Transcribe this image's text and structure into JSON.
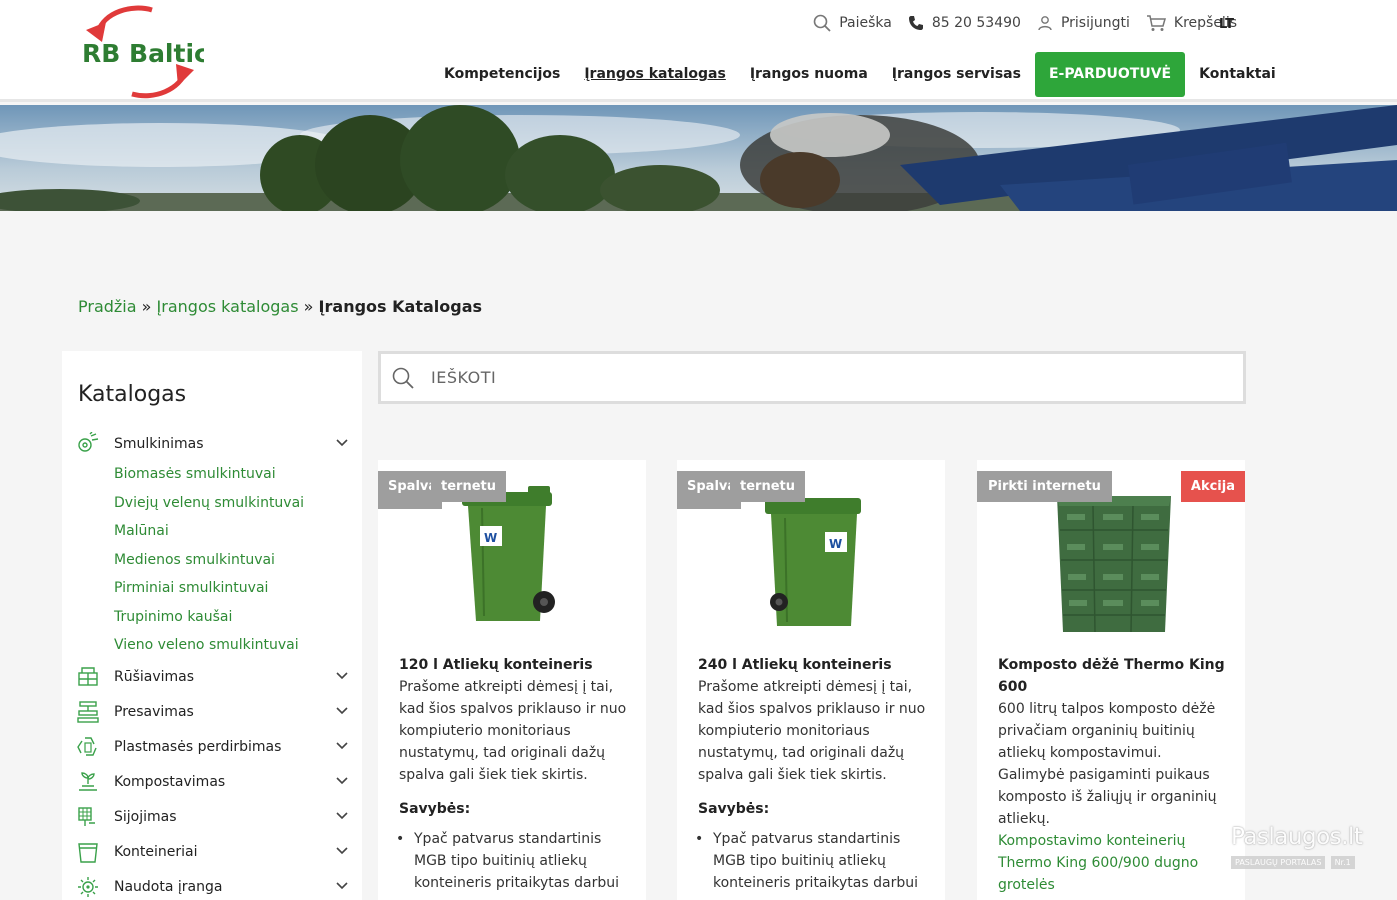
{
  "brand": {
    "logo_text": "RB Baltic",
    "green": "#2e8b35",
    "accent_red": "#e03a3a"
  },
  "topbar": {
    "search_label": "Paieška",
    "phone": "85 20 53490",
    "login_label": "Prisijungti",
    "cart_label": "Krepšelis",
    "language": "LT"
  },
  "nav": {
    "items": [
      {
        "label": "Kompetencijos"
      },
      {
        "label": "Įrangos katalogas"
      },
      {
        "label": "Įrangos nuoma"
      },
      {
        "label": "Įrangos servisas"
      },
      {
        "label": "E-PARDUOTUVĖ"
      },
      {
        "label": "Kontaktai"
      }
    ]
  },
  "breadcrumb": {
    "home": "Pradžia",
    "sep1": "»",
    "catalog": "Įrangos katalogas",
    "sep2": "»",
    "current": "Įrangos Katalogas"
  },
  "sidebar": {
    "title": "Katalogas",
    "categories": [
      {
        "label": "Smulkinimas",
        "icon": "shredder-icon"
      },
      {
        "label": "Rūšiavimas",
        "icon": "sorting-icon"
      },
      {
        "label": "Presavimas",
        "icon": "press-icon"
      },
      {
        "label": "Plastmasės perdirbimas",
        "icon": "recycle-icon"
      },
      {
        "label": "Kompostavimas",
        "icon": "compost-icon"
      },
      {
        "label": "Sijojimas",
        "icon": "sieve-icon"
      },
      {
        "label": "Konteineriai",
        "icon": "container-icon"
      },
      {
        "label": "Naudota įranga",
        "icon": "used-equipment-icon"
      }
    ],
    "subcategories": [
      "Biomasės smulkintuvai",
      "Dviejų velenų smulkintuvai",
      "Malūnai",
      "Medienos smulkintuvai",
      "Pirminiai smulkintuvai",
      "Trupinimo kaušai",
      "Vieno veleno smulkintuvai"
    ]
  },
  "search": {
    "placeholder": "IEŠKOTI"
  },
  "products": [
    {
      "badge_a": "Spalva",
      "badge_b": "ternetu",
      "title": "120 l Atliekų konteineris",
      "description": "Prašome atkreipti dėmesį į tai, kad šios spalvos priklauso ir nuo kompiuterio monitoriaus nustatymų, tad originali dažų spalva gali šiek tiek skirtis.",
      "features_label": "Savybės:",
      "feature": "Ypač patvarus standartinis MGB tipo buitinių atliekų konteineris pritaikytas darbui"
    },
    {
      "badge_a": "Spalva",
      "badge_b": "ternetu",
      "title": "240 l Atliekų konteineris",
      "description": "Prašome atkreipti dėmesį į tai, kad šios spalvos priklauso ir nuo kompiuterio monitoriaus nustatymų, tad originali dažų spalva gali šiek tiek skirtis.",
      "features_label": "Savybės:",
      "feature": "Ypač patvarus standartinis MGB tipo buitinių atliekų konteineris pritaikytas darbui"
    },
    {
      "badge": "Pirkti internetu",
      "sale": "Akcija",
      "title": "Komposto dėžė Thermo King 600",
      "description": "600 litrų talpos komposto dėžė privačiam organinių buitinių atliekų kompostavimui. Galimybė pasigaminti puikaus komposto iš žaliųjų ir organinių atliekų.",
      "link": "Kompostavimo konteinerių Thermo King 600/900 dugno grotelės"
    }
  ],
  "watermark": {
    "text": "Paslaugos.lt",
    "sub": "PASLAUGŲ PORTALAS",
    "badge": "Nr.1"
  }
}
